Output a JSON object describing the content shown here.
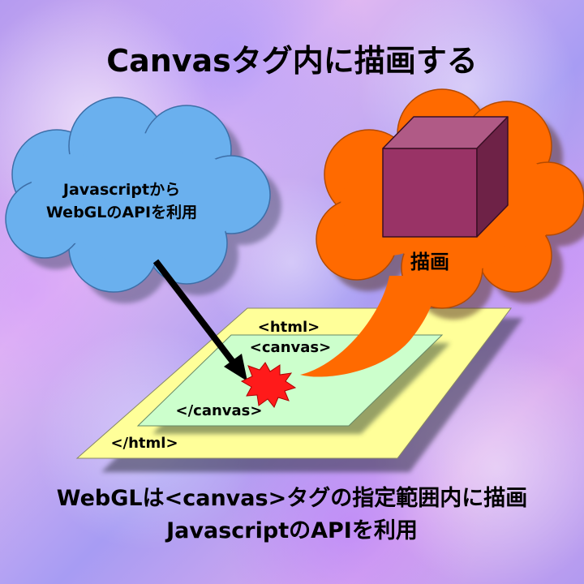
{
  "title": "Canvasタグ内に描画する",
  "left_cloud": {
    "line1": "Javascriptから",
    "line2": "WebGLのAPIを利用"
  },
  "right_cloud": {
    "label": "描画"
  },
  "html_layer": {
    "open_tag": "<html>",
    "close_tag": "</html>"
  },
  "canvas_layer": {
    "open_tag": "<canvas>",
    "close_tag": "</canvas>"
  },
  "caption": {
    "line1": "WebGLは<canvas>タグの指定範囲内に描画",
    "line2": "JavascriptのAPIを利用"
  },
  "colors": {
    "blue_cloud": "#6ab0ee",
    "orange_cloud": "#ff6a00",
    "cube_front": "#993366",
    "cube_top": "#b05a86",
    "cube_side": "#6e2247",
    "html_layer": "#ffff99",
    "canvas_layer": "#ccffcc",
    "burst": "#ff1a1a"
  }
}
